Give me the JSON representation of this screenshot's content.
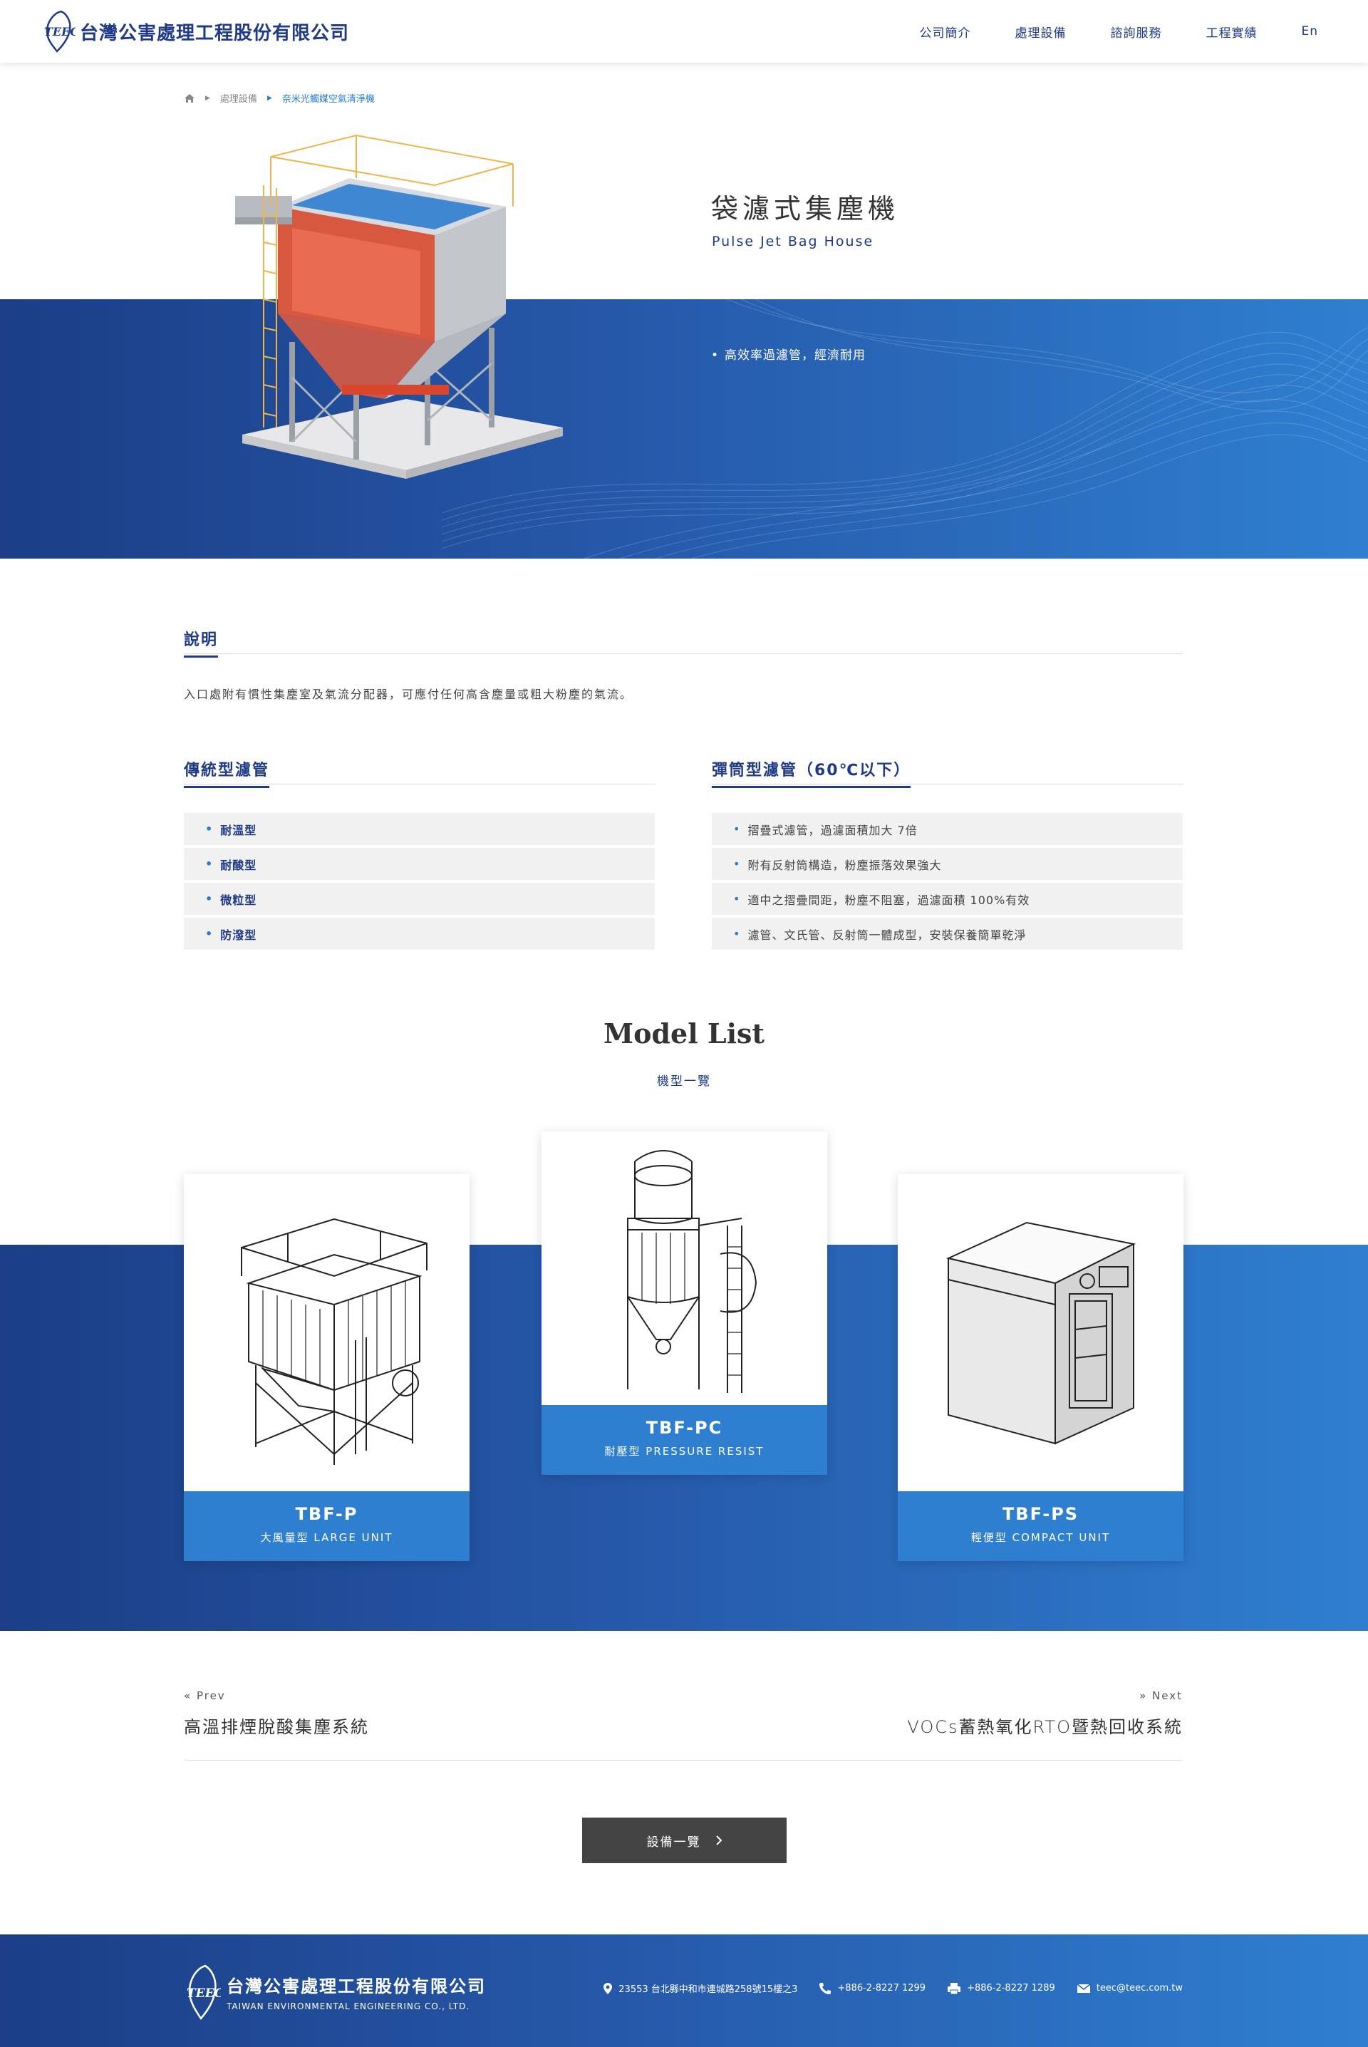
{
  "header": {
    "company_name": "台灣公害處理工程股份有限公司",
    "logo_mark": "TEEC",
    "nav": [
      "公司簡介",
      "處理設備",
      "諮詢服務",
      "工程實績",
      "En"
    ]
  },
  "breadcrumb": {
    "home_icon": "home-icon",
    "items": [
      "處理設備",
      "奈米光觸媒空氣清淨機"
    ]
  },
  "hero": {
    "title": "袋濾式集塵機",
    "subtitle": "Pulse Jet Bag House",
    "bullet": "高效率過濾管，經濟耐用"
  },
  "description": {
    "heading": "說明",
    "text": "入口處附有慣性集塵室及氣流分配器，可應付任何高含塵量或粗大粉塵的氣流。"
  },
  "traditional_filter": {
    "heading": "傳統型濾管",
    "items": [
      "耐溫型",
      "耐酸型",
      "微粒型",
      "防潑型"
    ]
  },
  "cartridge_filter": {
    "heading": "彈筒型濾管（60℃以下）",
    "items": [
      "摺疊式濾管，過濾面積加大 7倍",
      "附有反射筒構造，粉塵振落效果強大",
      "適中之摺疊間距，粉塵不阻塞，過濾面積 100%有效",
      "濾管、文氏管、反射筒一體成型，安裝保養簡單乾淨"
    ]
  },
  "model_list": {
    "title": "Model List",
    "subtitle": "機型一覽",
    "models": [
      {
        "name": "TBF-P",
        "desc": "大風量型 LARGE UNIT"
      },
      {
        "name": "TBF-PC",
        "desc": "耐壓型 PRESSURE RESIST"
      },
      {
        "name": "TBF-PS",
        "desc": "輕便型 COMPACT UNIT"
      }
    ]
  },
  "pager": {
    "prev_label": "« Prev",
    "prev_title": "高溫排煙脫酸集塵系統",
    "next_label": "» Next",
    "next_title": "VOCs蓄熱氧化RTO暨熱回收系統"
  },
  "list_button": {
    "label": "設備一覽"
  },
  "footer": {
    "company_name": "台灣公害處理工程股份有限公司",
    "company_en": "TAIWAN ENVIRONMENTAL ENGINEERING CO., LTD.",
    "address": "23553 台北縣中和市連城路258號15樓之3",
    "phone": "+886-2-8227 1299",
    "fax": "+886-2-8227 1289",
    "email": "teec@teec.com.tw"
  },
  "colors": {
    "brand_dark": "#1b3e86",
    "brand_light": "#2f7fd0",
    "button": "#444444"
  }
}
